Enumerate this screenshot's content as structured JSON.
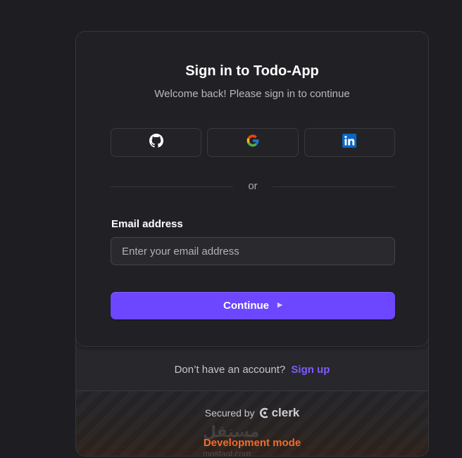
{
  "header": {
    "title": "Sign in to Todo-App",
    "subtitle": "Welcome back! Please sign in to continue"
  },
  "social": [
    {
      "provider": "GitHub",
      "icon": "github-icon"
    },
    {
      "provider": "Google",
      "icon": "google-icon"
    },
    {
      "provider": "LinkedIn",
      "icon": "linkedin-icon"
    }
  ],
  "divider": {
    "text": "or"
  },
  "form": {
    "email_label": "Email address",
    "email_placeholder": "Enter your email address",
    "email_value": "",
    "continue_label": "Continue",
    "continue_icon": "play-triangle-icon"
  },
  "signup": {
    "prompt": "Don’t have an account?",
    "link": "Sign up"
  },
  "footer": {
    "secured_by": "Secured by",
    "brand": "clerk",
    "dev_mode": "Development mode"
  },
  "watermark": {
    "logo_text": "مستقل",
    "site": "mostaql.com"
  },
  "colors": {
    "background": "#1e1d21",
    "card": "#212025",
    "accent": "#6c47ff",
    "link": "#7d5cff",
    "dev_mode": "#f36b2b"
  }
}
